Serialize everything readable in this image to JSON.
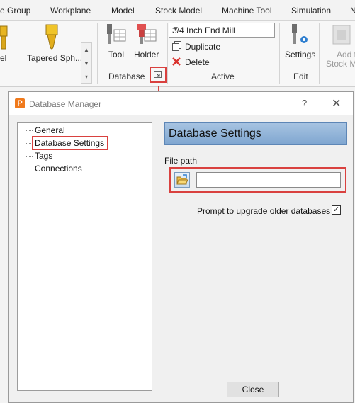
{
  "ribbon": {
    "tabs": [
      "e Group",
      "Workplane",
      "Model",
      "Stock Model",
      "Machine Tool",
      "Simulation",
      "N"
    ],
    "left_tool_labels": [
      "el",
      "Tapered Sph..."
    ],
    "database_group": {
      "label": "Database",
      "tool_label": "Tool",
      "holder_label": "Holder"
    },
    "active_group": {
      "label": "Active",
      "combo_value": "3/4 Inch End Mill",
      "duplicate_label": "Duplicate",
      "delete_label": "Delete"
    },
    "edit_group": {
      "label": "Edit",
      "settings_label": "Settings"
    },
    "add_stock_label_1": "Add t",
    "add_stock_label_2": "Stock M"
  },
  "dialog": {
    "app_icon": "P",
    "title": "Database Manager",
    "help": "?",
    "close": "✕",
    "tree": [
      "General",
      "Database Settings",
      "Tags",
      "Connections"
    ],
    "header": "Database Settings",
    "file_path_label": "File path",
    "file_path_value": "",
    "prompt_label": "Prompt to upgrade older databases",
    "prompt_checked": "✓",
    "close_button": "Close"
  },
  "colors": {
    "highlight": "#d9413f",
    "header_top": "#a8c4e2",
    "header_bottom": "#7fa6d0"
  }
}
